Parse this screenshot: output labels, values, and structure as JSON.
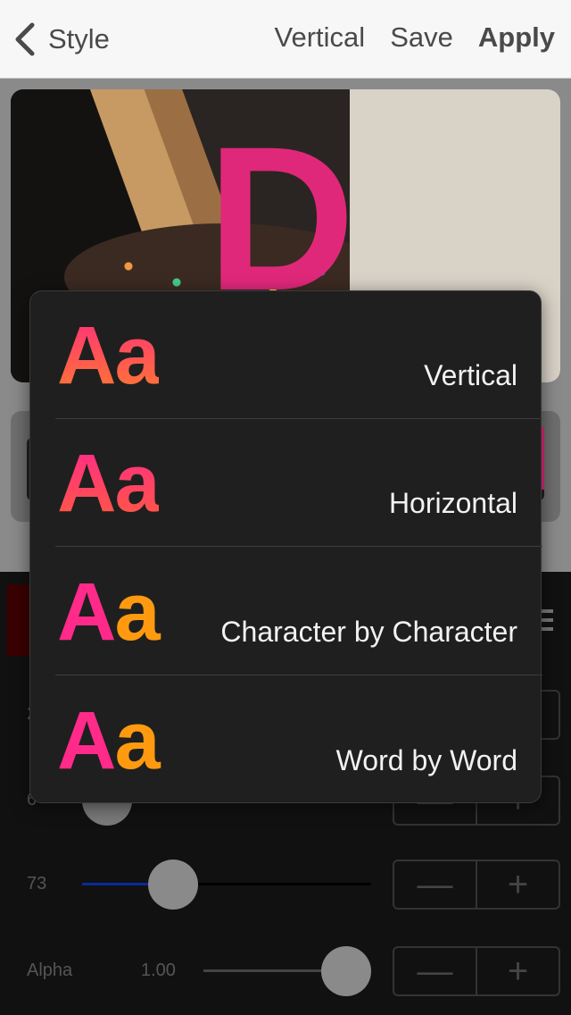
{
  "nav": {
    "back_label": "Style",
    "actions": [
      "Vertical",
      "Save",
      "Apply"
    ]
  },
  "popover": {
    "items": [
      {
        "sample": "Aa",
        "label": "Vertical"
      },
      {
        "sample": "Aa",
        "label": "Horizontal"
      },
      {
        "sample_A": "A",
        "sample_a": "a",
        "label": "Character by Character"
      },
      {
        "sample_A": "A",
        "sample_a": "a",
        "label": "Word by Word"
      }
    ]
  },
  "controls": {
    "row1": {
      "label": "2"
    },
    "row2": {
      "label": "6"
    },
    "row3": {
      "label": "73",
      "level": 0.29
    },
    "row4": {
      "label": "Alpha",
      "value": "1.00",
      "level": 0.82
    },
    "stepper": {
      "minus": "—",
      "plus": "+"
    }
  },
  "colors": {
    "accent_pink": "#ff2a8a",
    "accent_orange": "#ff9a10",
    "slider_fill": "#0a2a9a"
  }
}
